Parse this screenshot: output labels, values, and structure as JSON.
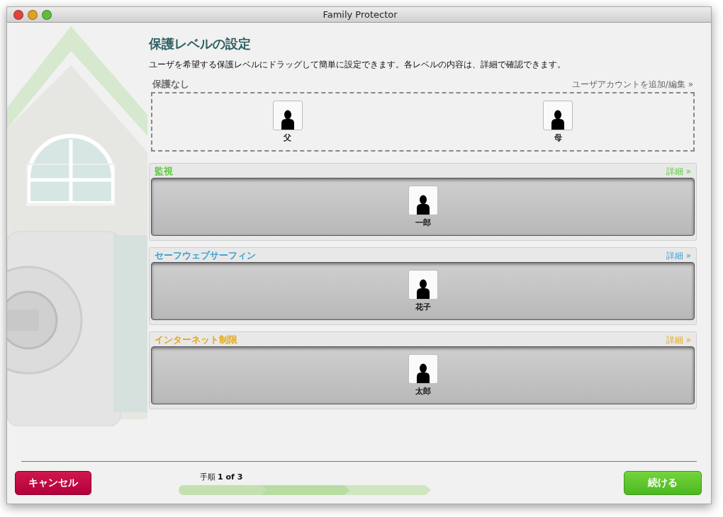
{
  "window": {
    "title": "Family Protector"
  },
  "heading": "保護レベルの設定",
  "description": "ユーザを希望する保護レベルにドラッグして簡単に設定できます。各レベルの内容は、詳細で確認できます。",
  "levels": [
    {
      "kind": "open",
      "title": "保護なし",
      "color": "#6e6e6e",
      "link": "ユーザアカウントを追加/編集 »",
      "users": [
        "父",
        "母"
      ]
    },
    {
      "kind": "tray",
      "title": "監視",
      "color": "#5cc83c",
      "link": "詳細 »",
      "users": [
        "一郎"
      ]
    },
    {
      "kind": "tray",
      "title": "セーフウェブサーフィン",
      "color": "#3fa0d0",
      "link": "詳細 »",
      "users": [
        "花子"
      ]
    },
    {
      "kind": "tray",
      "title": "インターネット制限",
      "color": "#e8a816",
      "link": "詳細 »",
      "users": [
        "太郎"
      ]
    }
  ],
  "footer": {
    "cancel": "キャンセル",
    "step": "手順 **1 of 3**",
    "continue": "続ける"
  }
}
